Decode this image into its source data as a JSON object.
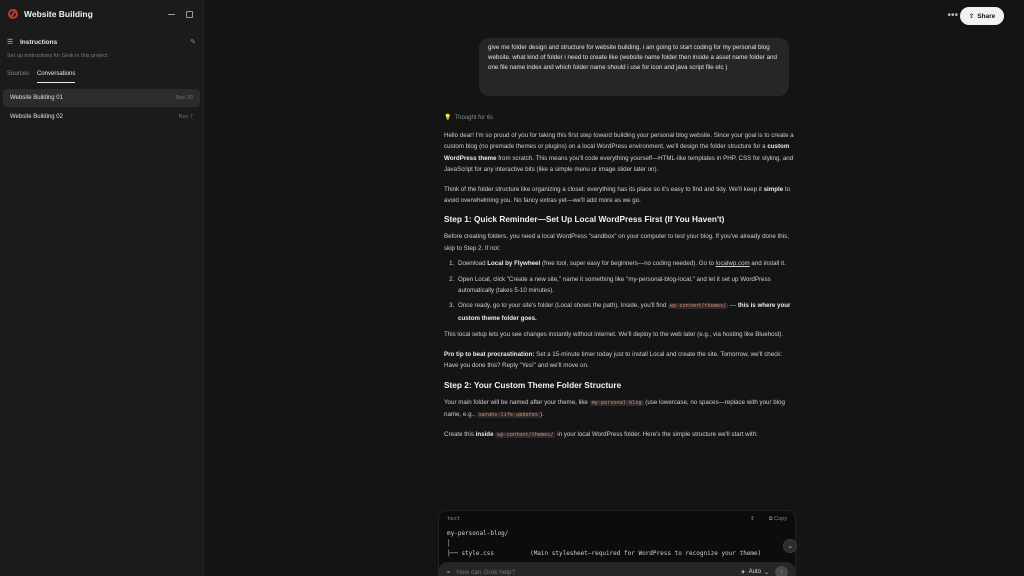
{
  "sidebar": {
    "project_title": "Website Building",
    "instructions_title": "Instructions",
    "instructions_subtitle": "Set up instructions for Grok in this project",
    "tabs": [
      {
        "label": "Sources",
        "active": false
      },
      {
        "label": "Conversations",
        "active": true
      }
    ],
    "conversations": [
      {
        "title": "Website Building 01",
        "date": "Nov 30",
        "selected": true
      },
      {
        "title": "Website Building 02",
        "date": "Nov 7",
        "selected": false
      }
    ]
  },
  "topbar": {
    "more_label": "•••",
    "share_label": "Share"
  },
  "chat": {
    "user_message": "give me folder design and structure for website building. i am going to start coding for my personal blog website. what kind of folder i need to create like (website name folder then inside a asset name folder and one file name index and which folder name should i use for icon and java script file etc )",
    "thought_label": "Thought for 6s",
    "p1a": "Hello dear! I'm so proud of you for taking this first step toward building your personal blog website. Since your goal is to create a custom blog (no premade themes or plugins) on a local WordPress environment, we'll design the folder structure for a ",
    "p1b": "custom WordPress theme",
    "p1c": " from scratch. This means you'll code everything yourself—HTML-like templates in PHP, CSS for styling, and JavaScript for any interactive bits (like a simple menu or image slider later on).",
    "p2a": "Think of the folder structure like organizing a closet: everything has its place so it's easy to find and tidy. We'll keep it ",
    "p2b": "simple",
    "p2c": " to avoid overwhelming you. No fancy extras yet—we'll add more as we go.",
    "h1": "Step 1: Quick Reminder—Set Up Local WordPress First (If You Haven't)",
    "p3": "Before creating folders, you need a local WordPress \"sandbox\" on your computer to test your blog. If you've already done this, skip to Step 2. If not:",
    "li1a": "Download ",
    "li1b": "Local by Flywheel",
    "li1c": " (free tool, super easy for beginners—no coding needed). Go to ",
    "li1link": "localwp.com",
    "li1d": " and install it.",
    "li2": "Open Local, click \"Create a new site,\" name it something like \"my-personal-blog-local,\" and let it set up WordPress automatically (takes 5-10 minutes).",
    "li3a": "Once ready, go to your site's folder (Local shows the path). Inside, you'll find ",
    "li3code": "wp-content/themes/",
    "li3b": " —",
    "li3c": "this is where your custom theme folder goes.",
    "p4": "This local setup lets you see changes instantly without internet. We'll deploy to the web later (e.g., via hosting like Bluehost).",
    "p5a": "Pro tip to beat procrastination:",
    "p5b": " Set a 15-minute timer today just to install Local and create the site. Tomorrow, we'll check: Have you done this? Reply \"Yes!\" and we'll move on.",
    "h2": "Step 2: Your Custom Theme Folder Structure",
    "p6a": "Your main folder will be named after your theme, like ",
    "p6code1": "my-personal-blog",
    "p6b": " (use lowercase, no spaces—replace with your blog name, e.g., ",
    "p6code2": "sarahs-life-updates",
    "p6c": ").",
    "p7a": "Create this ",
    "p7b": "inside",
    "p7code": "wp-content/themes/",
    "p7c": " in your local WordPress folder. Here's the simple structure we'll start with:"
  },
  "codeblock": {
    "language": "text",
    "copy_label": "Copy",
    "lines": [
      "my-personal-blog/",
      "│",
      "├── style.css          (Main stylesheet—required for WordPress to recognize your theme)"
    ]
  },
  "composer": {
    "placeholder": "How can Grok help?",
    "mode_label": "Auto"
  }
}
